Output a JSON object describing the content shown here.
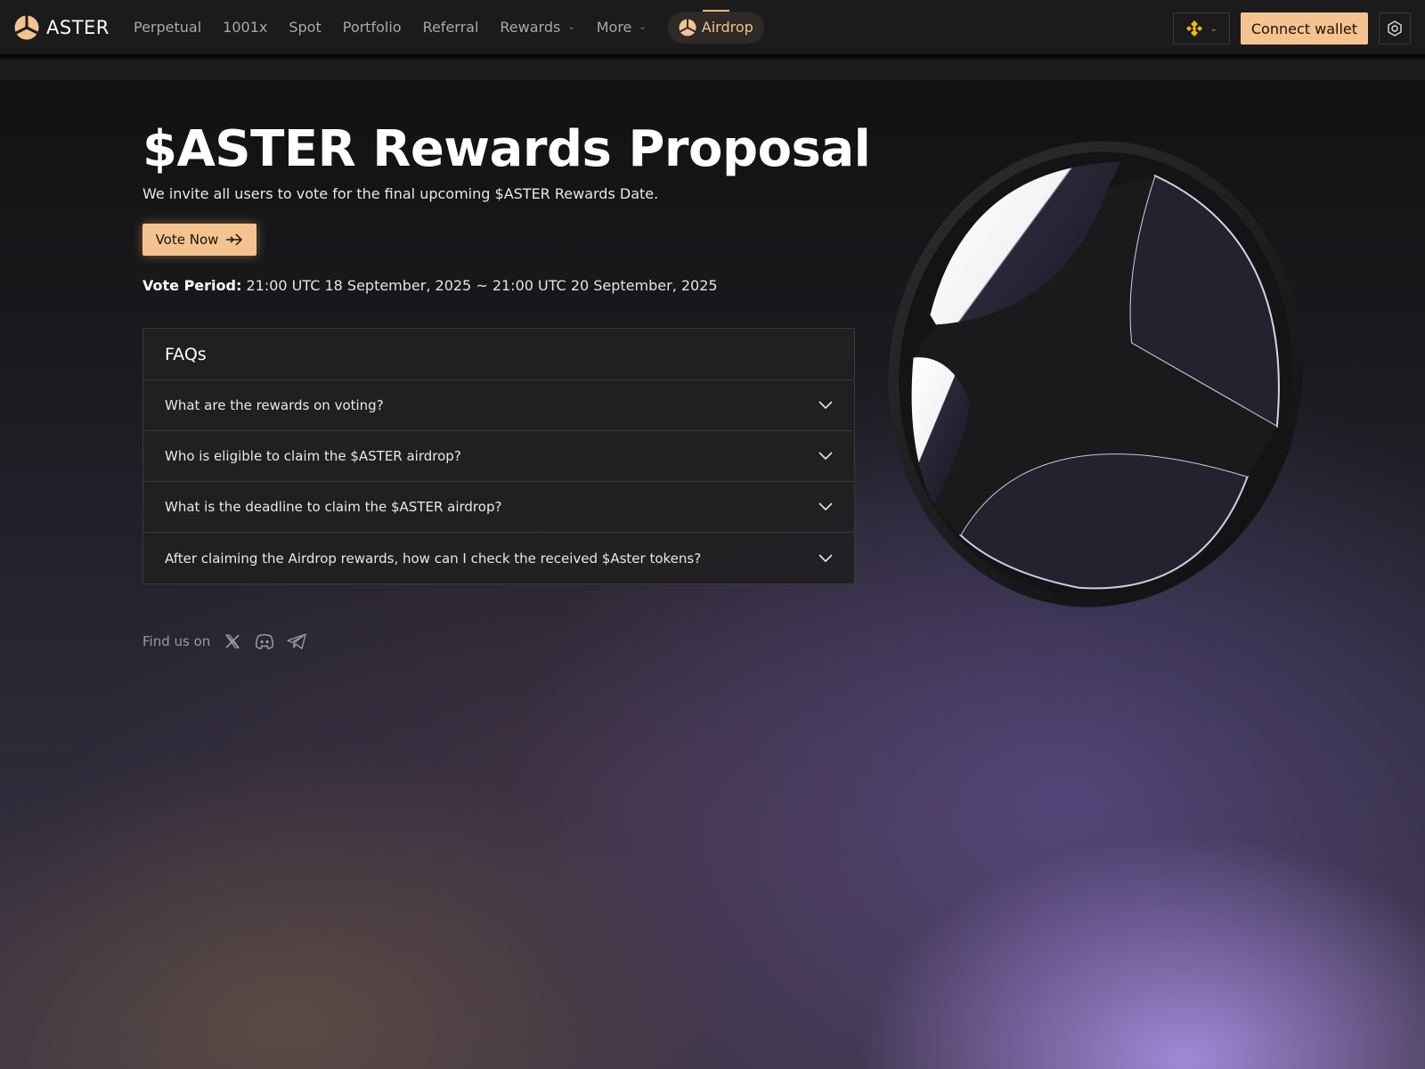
{
  "brand": {
    "name": "ASTER"
  },
  "nav": {
    "items": [
      {
        "label": "Perpetual"
      },
      {
        "label": "1001x"
      },
      {
        "label": "Spot"
      },
      {
        "label": "Portfolio"
      },
      {
        "label": "Referral"
      },
      {
        "label": "Rewards"
      },
      {
        "label": "More"
      }
    ],
    "airdrop_label": "Airdrop"
  },
  "header": {
    "chain_icon": "bnb-chain-icon",
    "connect_label": "Connect wallet",
    "settings_icon": "settings-icon"
  },
  "hero": {
    "title": "$ASTER Rewards Proposal",
    "subtitle": "We invite all users to vote for the final upcoming $ASTER Rewards Date.",
    "vote_button": "Vote Now",
    "vote_period_label": "Vote Period:",
    "vote_period_value": " 21:00 UTC 18 September, 2025 ~ 21:00 UTC 20 September, 2025"
  },
  "faq": {
    "title": "FAQs",
    "items": [
      {
        "question": "What are the rewards on voting?"
      },
      {
        "question": "Who is eligible to claim the $ASTER airdrop?"
      },
      {
        "question": "What is the deadline to claim the $ASTER airdrop?"
      },
      {
        "question": "After claiming the Airdrop rewards, how can I check the received $Aster tokens?"
      }
    ]
  },
  "social": {
    "label": "Find us on",
    "icons": [
      "x-icon",
      "discord-icon",
      "telegram-icon"
    ]
  },
  "colors": {
    "accent": "#f4c38f",
    "topbar": "#1b1b1b"
  }
}
